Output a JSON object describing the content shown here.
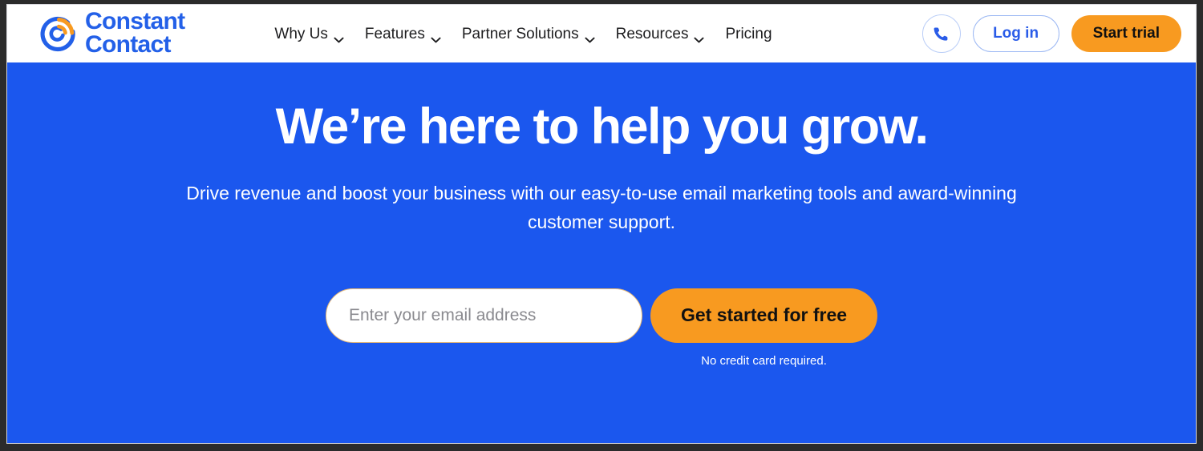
{
  "colors": {
    "brand_blue": "#2360e8",
    "hero_blue": "#1b57ee",
    "accent_orange": "#f89a20",
    "nav_text": "#1d1d1f",
    "white": "#ffffff"
  },
  "header": {
    "brand": {
      "logo_icon": "constant-contact-circle-logo",
      "name_line1": "Constant",
      "name_line2": "Contact"
    },
    "nav": [
      {
        "label": "Why Us",
        "has_dropdown": true
      },
      {
        "label": "Features",
        "has_dropdown": true
      },
      {
        "label": "Partner Solutions",
        "has_dropdown": true
      },
      {
        "label": "Resources",
        "has_dropdown": true
      },
      {
        "label": "Pricing",
        "has_dropdown": false
      }
    ],
    "actions": {
      "phone_icon": "phone-icon",
      "login_label": "Log in",
      "trial_label": "Start trial"
    }
  },
  "hero": {
    "title": "We’re here to help you grow.",
    "subtitle": "Drive revenue and boost your business with our easy-to-use email marketing tools and award-winning customer support.",
    "email_placeholder": "Enter your email address",
    "email_value": "",
    "cta_label": "Get started for free",
    "cta_note": "No credit card required."
  }
}
